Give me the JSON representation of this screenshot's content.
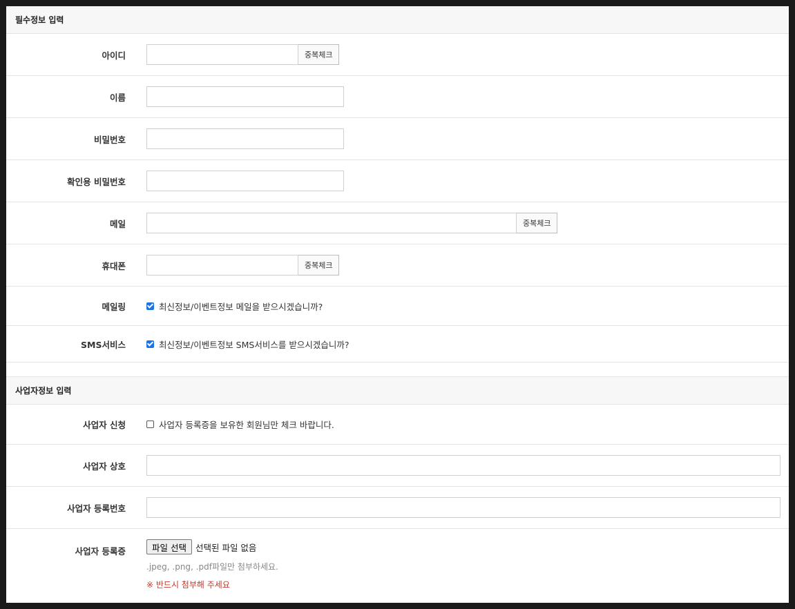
{
  "required_section": {
    "title": "필수정보 입력",
    "id": {
      "label": "아이디",
      "value": "",
      "button": "중복체크"
    },
    "name": {
      "label": "이름",
      "value": ""
    },
    "password": {
      "label": "비밀번호",
      "value": ""
    },
    "password_confirm": {
      "label": "확인용 비밀번호",
      "value": ""
    },
    "email": {
      "label": "메일",
      "value": "",
      "button": "중복체크"
    },
    "phone": {
      "label": "휴대폰",
      "value": "",
      "button": "중복체크"
    },
    "mailing": {
      "label": "메일링",
      "checked": true,
      "text": "최신정보/이벤트정보 메일을 받으시겠습니까?"
    },
    "sms": {
      "label": "SMS서비스",
      "checked": true,
      "text": "최신정보/이벤트정보 SMS서비스를 받으시겠습니까?"
    }
  },
  "business_section": {
    "title": "사업자정보 입력",
    "apply": {
      "label": "사업자 신청",
      "checked": false,
      "text": "사업자 등록증을 보유한 회원님만 체크 바랍니다."
    },
    "company_name": {
      "label": "사업자 상호",
      "value": ""
    },
    "reg_number": {
      "label": "사업자 등록번호",
      "value": ""
    },
    "certificate": {
      "label": "사업자 등록증",
      "file_button": "파일 선택",
      "file_status": "선택된 파일 없음",
      "hint": ".jpeg, .png, .pdf파일만 첨부하세요.",
      "warning": "※ 반드시 첨부해 주세요"
    }
  },
  "colors": {
    "checkbox_on": "#1a73e8",
    "warning": "#c0392b",
    "header_bg": "#f7f7f7"
  }
}
